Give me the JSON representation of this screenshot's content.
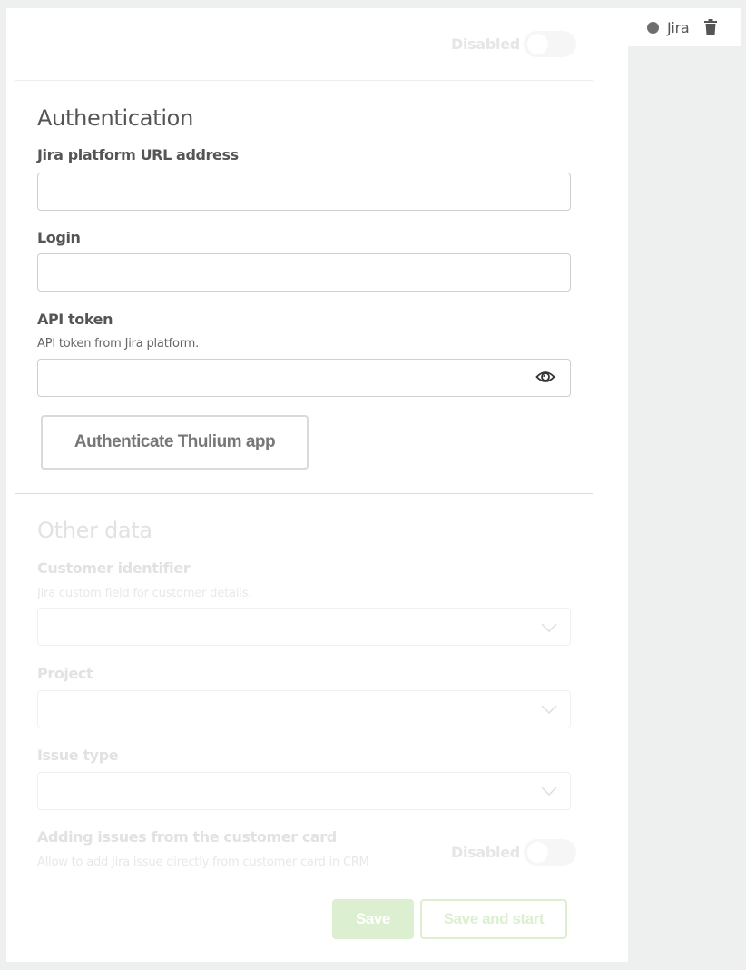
{
  "tab": {
    "name": "Jira",
    "status_color": "#6e6e6e",
    "delete_icon": "trash-icon"
  },
  "header": {
    "toggle_label": "Disabled",
    "toggle_on": false
  },
  "authentication": {
    "title": "Authentication",
    "url_field": {
      "label": "Jira platform URL address",
      "value": "",
      "placeholder": ""
    },
    "login_field": {
      "label": "Login",
      "value": "",
      "placeholder": ""
    },
    "token_field": {
      "label": "API token",
      "hint": "API token from Jira platform.",
      "value": "",
      "placeholder": "",
      "reveal_icon": "eye-icon"
    },
    "authenticate_button": "Authenticate Thulium app"
  },
  "other_data": {
    "title": "Other data",
    "customer_identifier": {
      "label": "Customer identifier",
      "hint": "Jira custom field for customer details.",
      "selected": ""
    },
    "project": {
      "label": "Project",
      "selected": ""
    },
    "issue_type": {
      "label": "Issue type",
      "selected": ""
    },
    "adding_issues": {
      "label": "Adding issues from the customer card",
      "hint": "Allow to add Jira issue directly from customer card in CRM",
      "toggle_label": "Disabled",
      "toggle_on": false
    }
  },
  "footer": {
    "save": "Save",
    "save_and_start": "Save and start",
    "accent_color": "#dcefd0"
  }
}
